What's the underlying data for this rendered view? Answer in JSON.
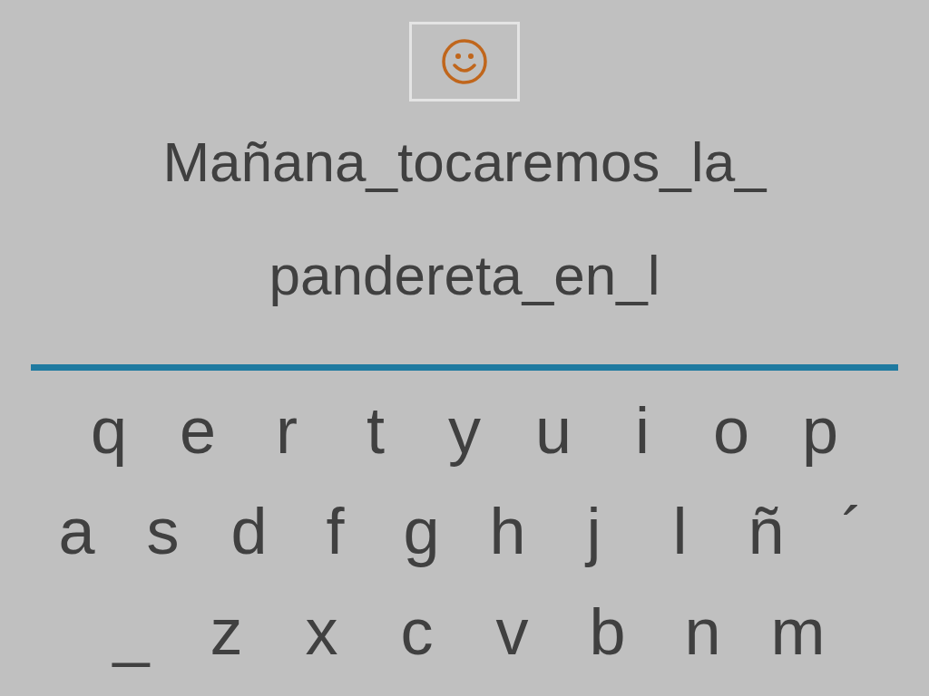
{
  "sentence": {
    "lines": [
      "Mañana_tocaremos_la_",
      "pandereta_en_l"
    ]
  },
  "keyboard": {
    "rows": [
      [
        "q",
        "e",
        "r",
        "t",
        "y",
        "u",
        "i",
        "o",
        "p"
      ],
      [
        "a",
        "s",
        "d",
        "f",
        "g",
        "h",
        "j",
        "l",
        "ñ",
        "´"
      ],
      [
        "_",
        "z",
        "x",
        "c",
        "v",
        "b",
        "n",
        "m"
      ]
    ]
  }
}
